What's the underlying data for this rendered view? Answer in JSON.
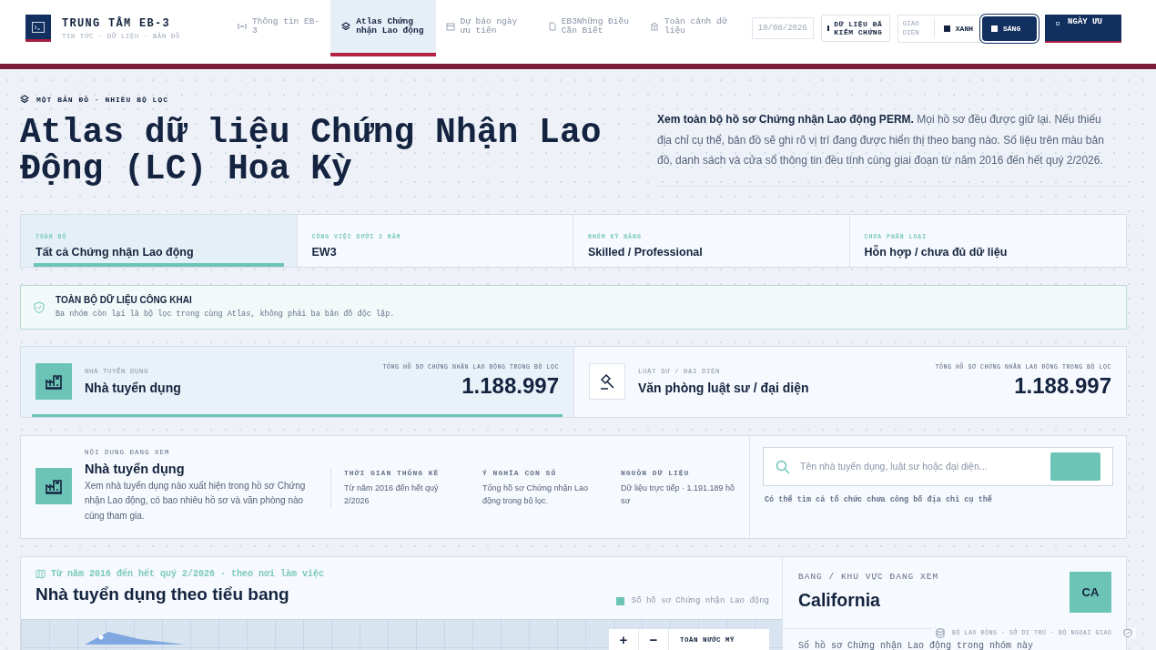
{
  "header": {
    "logo_title": "TRUNG TÂM EB-3",
    "logo_subtitle": "TIN TỨC · DỮ LIỆU · BẢN ĐỒ",
    "nav": [
      {
        "kind": "signal",
        "label": "Thông tin EB-3",
        "selected": false
      },
      {
        "kind": "layers",
        "label": "Atlas Chứng nhận Lao động",
        "selected": true
      },
      {
        "kind": "calendar",
        "label": "Dự báo ngày ưu tiên",
        "selected": false
      },
      {
        "kind": "doc",
        "label": "EB3Những Điều Cần Biết",
        "selected": false
      },
      {
        "kind": "bank",
        "label": "Toàn cảnh dữ liệu",
        "selected": false
      }
    ],
    "date": "10/08/2026",
    "verified_button": "DỮ LIỆU ĐÃ KIỂM CHỨNG",
    "theme_label": "GIAO DIỆN",
    "themes": [
      {
        "label": "XANH",
        "selected": false
      },
      {
        "label": "SÁNG",
        "selected": true
      }
    ],
    "priority_button": "NGÀY ƯU"
  },
  "hero": {
    "eyebrow": "MỘT BẢN ĐỒ · NHIỀU BỘ LỌC",
    "title": "Atlas dữ liệu Chứng Nhận Lao Động (LC) Hoa Kỳ",
    "intro": "**Xem toàn bộ hồ sơ Chứng nhận Lao động PERM.** Mọi hồ sơ đều được giữ lại. Nếu thiếu địa chỉ cụ thể, bản đồ sẽ ghi rõ vị trí đang được hiển thị theo bang nào. Số liệu trên màu bản đồ, danh sách và cửa sổ thông tin đều tính cùng giai đoạn từ năm 2016 đến hết quý 2/2026."
  },
  "filters": [
    {
      "label": "TOÀN BỘ",
      "value": "Tất cả Chứng nhận Lao động",
      "selected": true
    },
    {
      "label": "CÔNG VIỆC DƯỚI 2 NĂM",
      "value": "EW3",
      "selected": false
    },
    {
      "label": "NHÓM KỸ NĂNG",
      "value": "Skilled / Professional",
      "selected": false
    },
    {
      "label": "CHƯA PHÂN LOẠI",
      "value": "Hỗn hợp / chưa đủ dữ liệu",
      "selected": false
    }
  ],
  "notice": {
    "title": "TOÀN BỘ DỮ LIỆU CÔNG KHAI",
    "text": "Ba nhóm còn lại là bộ lọc trong cùng Atlas, không phải ba bản đồ độc lập."
  },
  "metrics": [
    {
      "kind": "employer",
      "label": "NHÀ TUYỂN DỤNG",
      "name": "Nhà tuyển dụng",
      "total_label": "TỔNG HỒ SƠ CHỨNG NHẬN LAO ĐỘNG TRONG BỘ LỌC",
      "total": "1.188.997",
      "selected": true
    },
    {
      "kind": "attorney",
      "label": "LUẬT SƯ / ĐẠI DIỆN",
      "name": "Văn phòng luật sư / đại diện",
      "total_label": "TỔNG HỒ SƠ CHỨNG NHẬN LAO ĐỘNG TRONG BỘ LỌC",
      "total": "1.188.997",
      "selected": false
    }
  ],
  "viewing": {
    "eyebrow": "NỘI DUNG ĐANG XEM",
    "title": "Nhà tuyển dụng",
    "description": "Xem nhà tuyển dụng nào xuất hiện trong hồ sơ Chứng nhận Lao động, có bao nhiêu hồ sơ và văn phòng nào cùng tham gia.",
    "stats": [
      {
        "label": "THỜI GIAN THỐNG KÊ",
        "value": "Từ năm 2016 đến hết quý 2/2026"
      },
      {
        "label": "Ý NGHĨA CON SỐ",
        "value": "Tổng hồ sơ Chứng nhận Lao động trong bộ lọc."
      },
      {
        "label": "NGUỒN DỮ LIỆU",
        "value": "Dữ liệu trực tiếp · 1.191.189 hồ sơ"
      }
    ]
  },
  "search": {
    "placeholder": "Tên nhà tuyển dụng, luật sư hoặc đại diện...",
    "hint": "Có thể tìm cả tổ chức chưa công bố địa chỉ cụ thể"
  },
  "map": {
    "eyebrow": "Từ năm 2016 đến hết quý 2/2026 · theo nơi làm việc",
    "title": "Nhà tuyển dụng theo tiểu bang",
    "legend": "Số hồ sơ Chứng nhận Lao động",
    "zoom_in": "+",
    "zoom_out": "−",
    "reset": "TOÀN NƯỚC MỸ"
  },
  "state_panel": {
    "eyebrow": "BANG / KHU VỰC ĐANG XEM",
    "name": "California",
    "code": "CA",
    "text": "Số hồ sơ Chứng nhận Lao động trong nhóm này"
  },
  "footer": {
    "sources": "BỘ LAO ĐỘNG · SỞ DI TRÚ · BỘ NGOẠI GIAO"
  }
}
